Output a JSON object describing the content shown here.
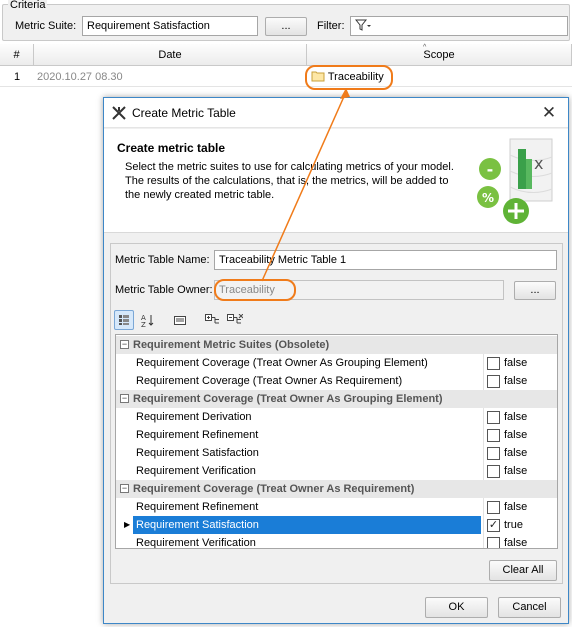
{
  "criteria": {
    "legend": "Criteria",
    "metric_suite_label": "Metric Suite:",
    "metric_suite_value": "Requirement Satisfaction",
    "browse_label": "...",
    "filter_label": "Filter:",
    "filter_icon": "funnel-icon"
  },
  "grid": {
    "headers": [
      "#",
      "Date",
      "Scope"
    ],
    "row": {
      "index": "1",
      "date": "2020.10.27 08.30",
      "scope": "Traceability"
    }
  },
  "dialog": {
    "title": "Create Metric Table",
    "close": "✕",
    "header_title": "Create metric table",
    "header_description": "Select the metric suites to use for calculating metrics of your model. The results of the calculations, that is, the metrics, will be added to the newly created metric table.",
    "name_label": "Metric Table Name:",
    "name_value": "Traceability Metric Table 1",
    "owner_label": "Metric Table Owner:",
    "owner_value": "Traceability",
    "owner_browse": "...",
    "groups": [
      {
        "title": "Requirement Metric Suites (Obsolete)",
        "expander": "−",
        "items": [
          {
            "name": "Requirement Coverage (Treat Owner As Grouping Element)",
            "value": "false",
            "checked": false
          },
          {
            "name": "Requirement Coverage (Treat Owner As Requirement)",
            "value": "false",
            "checked": false
          }
        ]
      },
      {
        "title": "Requirement Coverage (Treat Owner As Grouping Element)",
        "expander": "−",
        "items": [
          {
            "name": "Requirement Derivation",
            "value": "false",
            "checked": false
          },
          {
            "name": "Requirement Refinement",
            "value": "false",
            "checked": false
          },
          {
            "name": "Requirement Satisfaction",
            "value": "false",
            "checked": false
          },
          {
            "name": "Requirement Verification",
            "value": "false",
            "checked": false
          }
        ]
      },
      {
        "title": "Requirement Coverage (Treat Owner As Requirement)",
        "expander": "−",
        "items": [
          {
            "name": "Requirement Refinement",
            "value": "false",
            "checked": false
          },
          {
            "name": "Requirement Satisfaction",
            "value": "true",
            "checked": true,
            "selected": true
          },
          {
            "name": "Requirement Verification",
            "value": "false",
            "checked": false
          }
        ]
      }
    ],
    "clear_all": "Clear All",
    "ok": "OK",
    "cancel": "Cancel"
  },
  "colors": {
    "callout": "#f07b1a",
    "selection": "#1a7dd7",
    "dialog_border": "#3d87c7"
  }
}
